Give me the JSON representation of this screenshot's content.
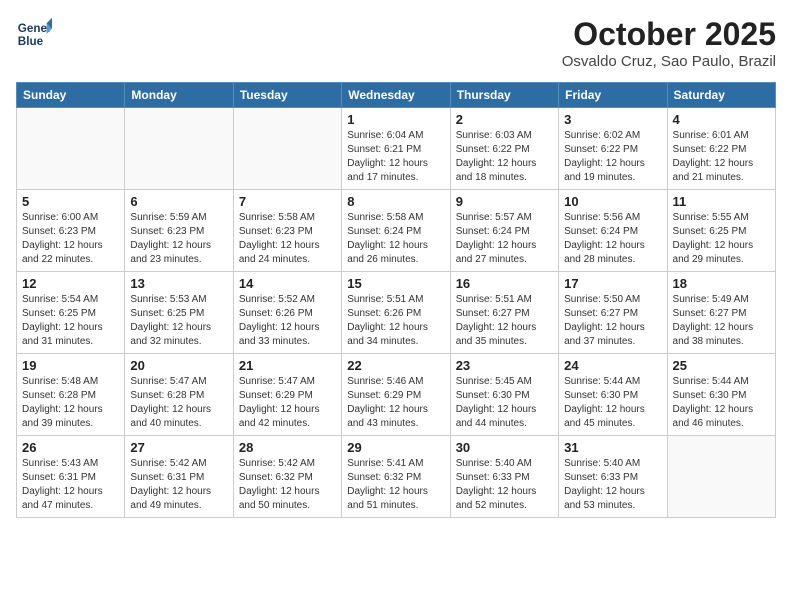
{
  "logo": {
    "line1": "General",
    "line2": "Blue"
  },
  "title": "October 2025",
  "subtitle": "Osvaldo Cruz, Sao Paulo, Brazil",
  "weekdays": [
    "Sunday",
    "Monday",
    "Tuesday",
    "Wednesday",
    "Thursday",
    "Friday",
    "Saturday"
  ],
  "weeks": [
    [
      {
        "day": "",
        "info": ""
      },
      {
        "day": "",
        "info": ""
      },
      {
        "day": "",
        "info": ""
      },
      {
        "day": "1",
        "info": "Sunrise: 6:04 AM\nSunset: 6:21 PM\nDaylight: 12 hours\nand 17 minutes."
      },
      {
        "day": "2",
        "info": "Sunrise: 6:03 AM\nSunset: 6:22 PM\nDaylight: 12 hours\nand 18 minutes."
      },
      {
        "day": "3",
        "info": "Sunrise: 6:02 AM\nSunset: 6:22 PM\nDaylight: 12 hours\nand 19 minutes."
      },
      {
        "day": "4",
        "info": "Sunrise: 6:01 AM\nSunset: 6:22 PM\nDaylight: 12 hours\nand 21 minutes."
      }
    ],
    [
      {
        "day": "5",
        "info": "Sunrise: 6:00 AM\nSunset: 6:23 PM\nDaylight: 12 hours\nand 22 minutes."
      },
      {
        "day": "6",
        "info": "Sunrise: 5:59 AM\nSunset: 6:23 PM\nDaylight: 12 hours\nand 23 minutes."
      },
      {
        "day": "7",
        "info": "Sunrise: 5:58 AM\nSunset: 6:23 PM\nDaylight: 12 hours\nand 24 minutes."
      },
      {
        "day": "8",
        "info": "Sunrise: 5:58 AM\nSunset: 6:24 PM\nDaylight: 12 hours\nand 26 minutes."
      },
      {
        "day": "9",
        "info": "Sunrise: 5:57 AM\nSunset: 6:24 PM\nDaylight: 12 hours\nand 27 minutes."
      },
      {
        "day": "10",
        "info": "Sunrise: 5:56 AM\nSunset: 6:24 PM\nDaylight: 12 hours\nand 28 minutes."
      },
      {
        "day": "11",
        "info": "Sunrise: 5:55 AM\nSunset: 6:25 PM\nDaylight: 12 hours\nand 29 minutes."
      }
    ],
    [
      {
        "day": "12",
        "info": "Sunrise: 5:54 AM\nSunset: 6:25 PM\nDaylight: 12 hours\nand 31 minutes."
      },
      {
        "day": "13",
        "info": "Sunrise: 5:53 AM\nSunset: 6:25 PM\nDaylight: 12 hours\nand 32 minutes."
      },
      {
        "day": "14",
        "info": "Sunrise: 5:52 AM\nSunset: 6:26 PM\nDaylight: 12 hours\nand 33 minutes."
      },
      {
        "day": "15",
        "info": "Sunrise: 5:51 AM\nSunset: 6:26 PM\nDaylight: 12 hours\nand 34 minutes."
      },
      {
        "day": "16",
        "info": "Sunrise: 5:51 AM\nSunset: 6:27 PM\nDaylight: 12 hours\nand 35 minutes."
      },
      {
        "day": "17",
        "info": "Sunrise: 5:50 AM\nSunset: 6:27 PM\nDaylight: 12 hours\nand 37 minutes."
      },
      {
        "day": "18",
        "info": "Sunrise: 5:49 AM\nSunset: 6:27 PM\nDaylight: 12 hours\nand 38 minutes."
      }
    ],
    [
      {
        "day": "19",
        "info": "Sunrise: 5:48 AM\nSunset: 6:28 PM\nDaylight: 12 hours\nand 39 minutes."
      },
      {
        "day": "20",
        "info": "Sunrise: 5:47 AM\nSunset: 6:28 PM\nDaylight: 12 hours\nand 40 minutes."
      },
      {
        "day": "21",
        "info": "Sunrise: 5:47 AM\nSunset: 6:29 PM\nDaylight: 12 hours\nand 42 minutes."
      },
      {
        "day": "22",
        "info": "Sunrise: 5:46 AM\nSunset: 6:29 PM\nDaylight: 12 hours\nand 43 minutes."
      },
      {
        "day": "23",
        "info": "Sunrise: 5:45 AM\nSunset: 6:30 PM\nDaylight: 12 hours\nand 44 minutes."
      },
      {
        "day": "24",
        "info": "Sunrise: 5:44 AM\nSunset: 6:30 PM\nDaylight: 12 hours\nand 45 minutes."
      },
      {
        "day": "25",
        "info": "Sunrise: 5:44 AM\nSunset: 6:30 PM\nDaylight: 12 hours\nand 46 minutes."
      }
    ],
    [
      {
        "day": "26",
        "info": "Sunrise: 5:43 AM\nSunset: 6:31 PM\nDaylight: 12 hours\nand 47 minutes."
      },
      {
        "day": "27",
        "info": "Sunrise: 5:42 AM\nSunset: 6:31 PM\nDaylight: 12 hours\nand 49 minutes."
      },
      {
        "day": "28",
        "info": "Sunrise: 5:42 AM\nSunset: 6:32 PM\nDaylight: 12 hours\nand 50 minutes."
      },
      {
        "day": "29",
        "info": "Sunrise: 5:41 AM\nSunset: 6:32 PM\nDaylight: 12 hours\nand 51 minutes."
      },
      {
        "day": "30",
        "info": "Sunrise: 5:40 AM\nSunset: 6:33 PM\nDaylight: 12 hours\nand 52 minutes."
      },
      {
        "day": "31",
        "info": "Sunrise: 5:40 AM\nSunset: 6:33 PM\nDaylight: 12 hours\nand 53 minutes."
      },
      {
        "day": "",
        "info": ""
      }
    ]
  ]
}
